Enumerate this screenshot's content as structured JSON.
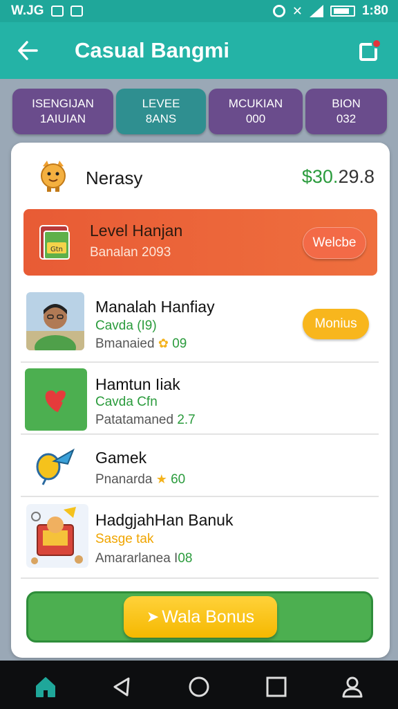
{
  "status_bar": {
    "left_text": "W.JG",
    "time": "1:80"
  },
  "header": {
    "title": "Casual Bangmi"
  },
  "tabs": [
    {
      "line1": "ISENGIJAN",
      "line2": "1AIUIAN"
    },
    {
      "line1": "LEVEE",
      "line2": "8ANS"
    },
    {
      "line1": "MCUKIAN",
      "line2": "000"
    },
    {
      "line1": "BION",
      "line2": "032"
    }
  ],
  "card": {
    "name": "Nerasy",
    "amount_prefix": "$30.",
    "amount_suffix": "29.8"
  },
  "level_banner": {
    "title": "Level Hanjan",
    "subtitle": "Banalan 2093",
    "button": "Welcbe",
    "icon_text": "Gtn"
  },
  "items": [
    {
      "title": "Manalah Hanfiay",
      "sub": "Cavda (I9)",
      "meta_label": "Bmanaied",
      "meta_value": "09",
      "button": "Monius"
    },
    {
      "title": "Hamtun Iiak",
      "sub": "Cavda Cfn",
      "meta_label": "Patatamaned",
      "meta_value": "2.7"
    },
    {
      "title": "Gamek",
      "meta_label": "Pnanarda",
      "meta_value": "60"
    },
    {
      "title": "HadgjahHan Banuk",
      "sub": "Sasge tak",
      "meta_label": "Amararlanea I",
      "meta_value": "08"
    }
  ],
  "bonus": {
    "button": "Wala Bonus"
  },
  "colors": {
    "teal": "#24b3a6",
    "purple": "#6a4c8c",
    "orange": "#e85b35",
    "green": "#4caf50",
    "yellow": "#f5b800"
  },
  "icons": {
    "back": "arrow-left-icon",
    "notif": "notification-icon",
    "nav": [
      "home-icon",
      "back-icon",
      "circle-home-icon",
      "recents-icon",
      "profile-icon"
    ]
  }
}
